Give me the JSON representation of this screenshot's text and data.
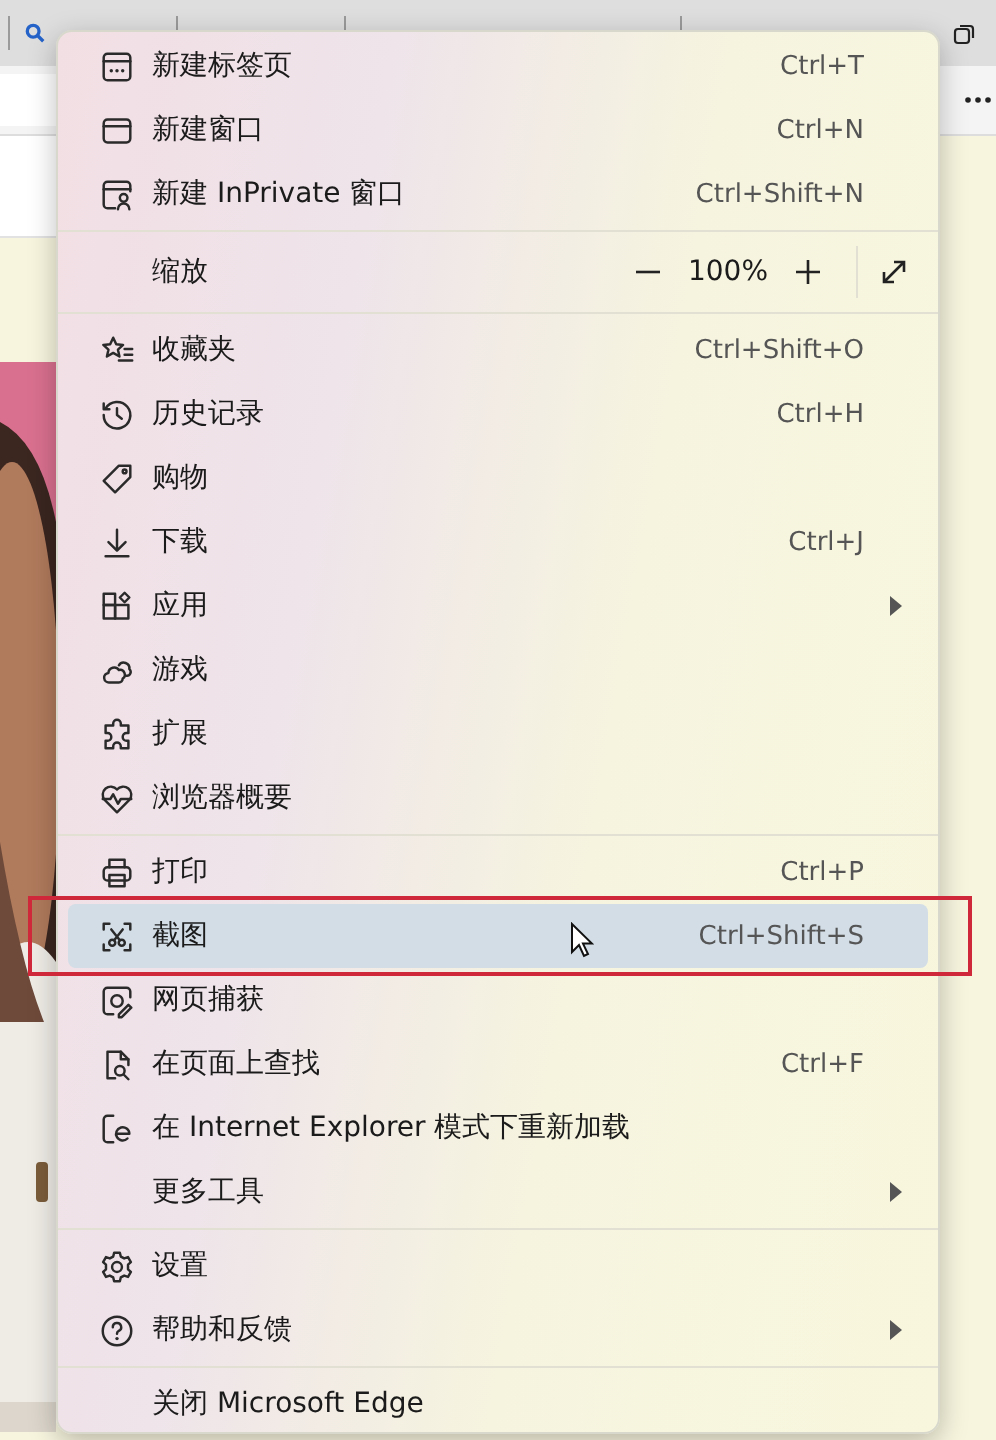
{
  "menu": {
    "groups": [
      {
        "items": [
          {
            "kind": "item",
            "label": "新建标签页",
            "shortcut": "Ctrl+T",
            "submenu": false,
            "selected": false
          },
          {
            "kind": "item",
            "label": "新建窗口",
            "shortcut": "Ctrl+N",
            "submenu": false,
            "selected": false
          },
          {
            "kind": "item",
            "label": "新建 InPrivate 窗口",
            "shortcut": "Ctrl+Shift+N",
            "submenu": false,
            "selected": false
          }
        ]
      },
      {
        "items": [
          {
            "kind": "zoom",
            "label": "缩放",
            "value": "100%"
          }
        ]
      },
      {
        "items": [
          {
            "kind": "item",
            "label": "收藏夹",
            "shortcut": "Ctrl+Shift+O",
            "submenu": false,
            "selected": false
          },
          {
            "kind": "item",
            "label": "历史记录",
            "shortcut": "Ctrl+H",
            "submenu": false,
            "selected": false
          },
          {
            "kind": "item",
            "label": "购物",
            "submenu": false,
            "selected": false
          },
          {
            "kind": "item",
            "label": "下载",
            "shortcut": "Ctrl+J",
            "submenu": false,
            "selected": false
          },
          {
            "kind": "item",
            "label": "应用",
            "submenu": true,
            "selected": false
          },
          {
            "kind": "item",
            "label": "游戏",
            "submenu": false,
            "selected": false
          },
          {
            "kind": "item",
            "label": "扩展",
            "submenu": false,
            "selected": false
          },
          {
            "kind": "item",
            "label": "浏览器概要",
            "submenu": false,
            "selected": false
          }
        ]
      },
      {
        "items": [
          {
            "kind": "item",
            "label": "打印",
            "shortcut": "Ctrl+P",
            "submenu": false,
            "selected": false
          },
          {
            "kind": "item",
            "label": "截图",
            "shortcut": "Ctrl+Shift+S",
            "submenu": false,
            "selected": true
          },
          {
            "kind": "item",
            "label": "网页捕获",
            "submenu": false,
            "selected": false
          },
          {
            "kind": "item",
            "label": "在页面上查找",
            "shortcut": "Ctrl+F",
            "submenu": false,
            "selected": false
          },
          {
            "kind": "item",
            "label": "在 Internet Explorer 模式下重新加载",
            "submenu": false,
            "selected": false
          },
          {
            "kind": "item",
            "label": "更多工具",
            "submenu": true,
            "selected": false
          }
        ]
      },
      {
        "items": [
          {
            "kind": "item",
            "label": "设置",
            "submenu": false,
            "selected": false
          },
          {
            "kind": "item",
            "label": "帮助和反馈",
            "submenu": true,
            "selected": false
          }
        ]
      },
      {
        "items": [
          {
            "kind": "item",
            "label": "关闭 Microsoft Edge",
            "submenu": false,
            "selected": false
          }
        ]
      }
    ]
  }
}
